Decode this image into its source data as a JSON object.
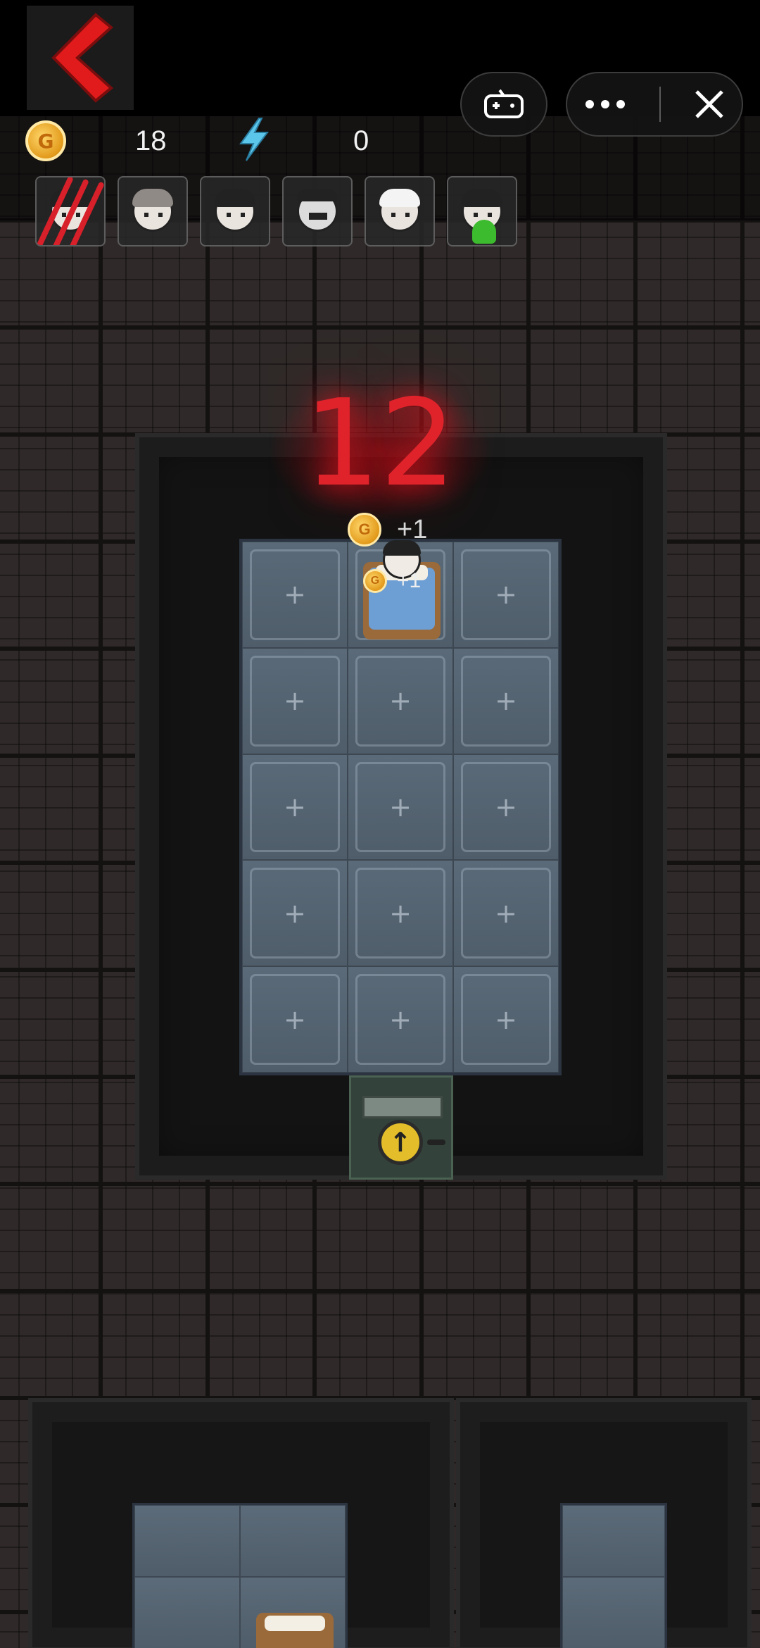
{
  "hud": {
    "gold_value": "18",
    "energy_value": "0",
    "gold_icon_letter": "G"
  },
  "avatars": [
    {
      "name": "claw-mark"
    },
    {
      "name": "grey-haired-person"
    },
    {
      "name": "black-haired-girl"
    },
    {
      "name": "masked-man"
    },
    {
      "name": "white-haired-girl"
    },
    {
      "name": "girl-with-green-tentacles"
    }
  ],
  "room": {
    "countdown": "12",
    "slot_symbol": "+",
    "gain_top": "+1",
    "gain_bed": "+1",
    "door_symbol": "↑"
  },
  "colors": {
    "countdown": "#e0232b",
    "back_arrow": "#e11b1b",
    "energy": "#5bc6ea",
    "gold": "#e29a1b"
  }
}
